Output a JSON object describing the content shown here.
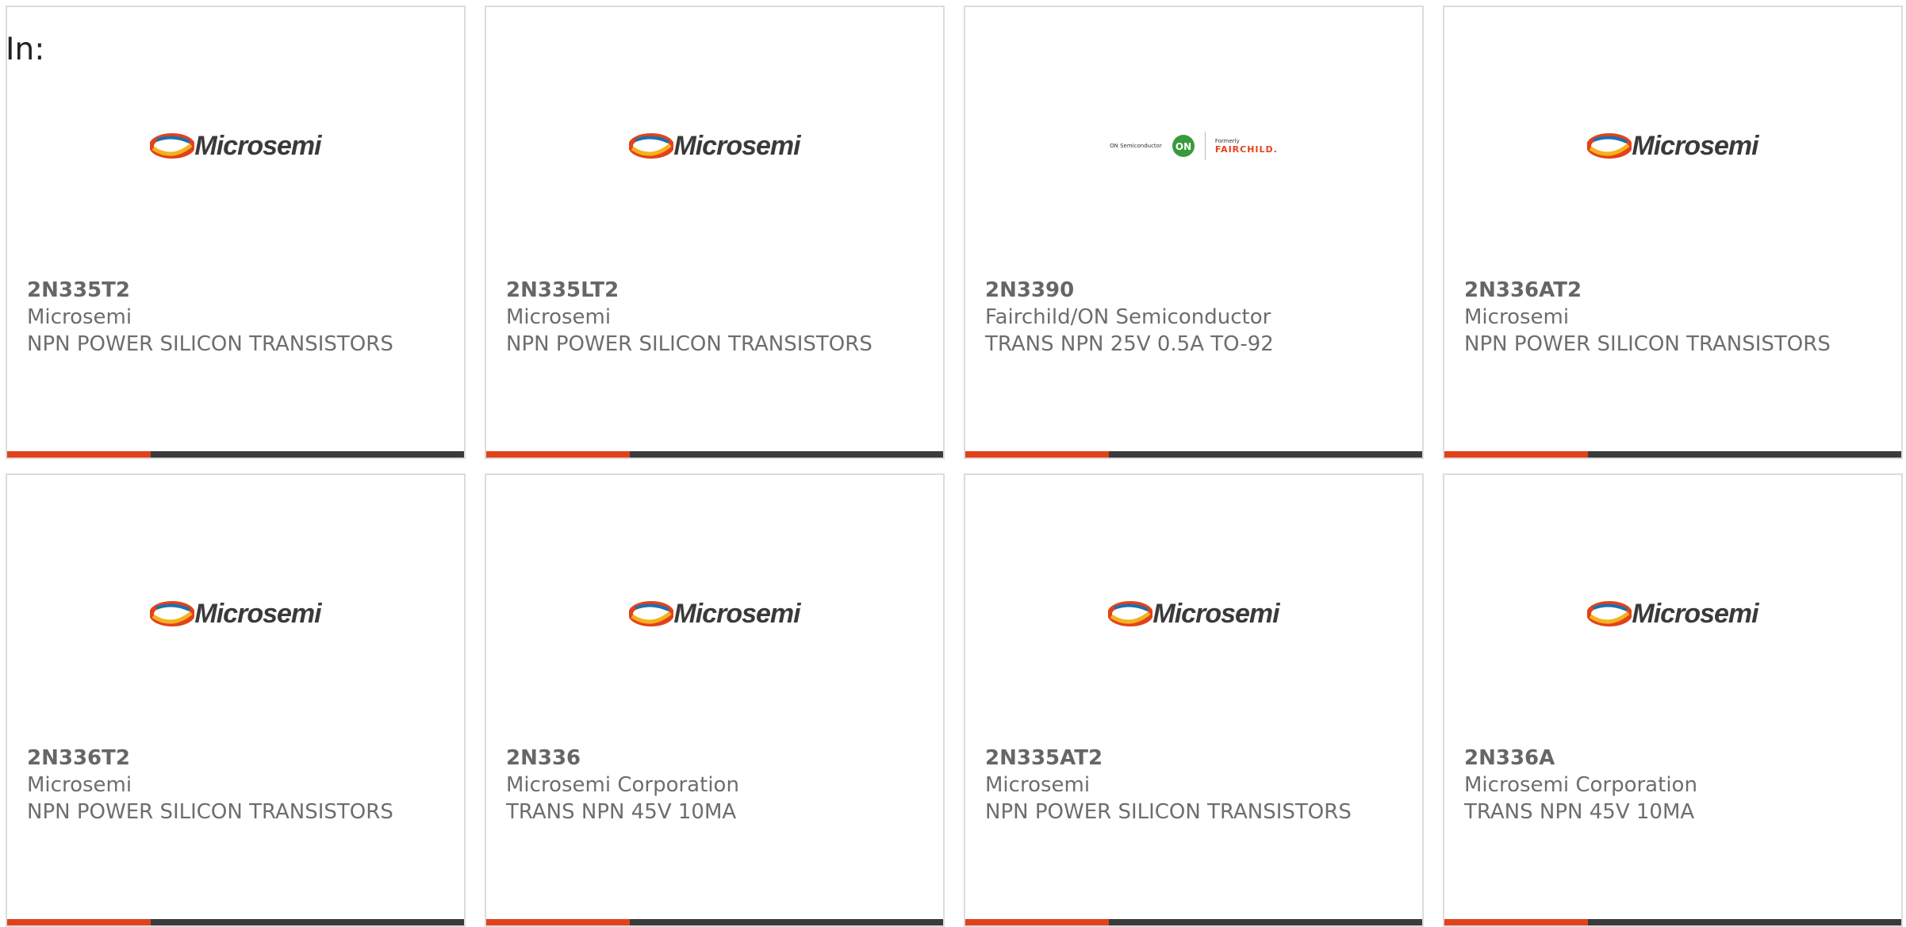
{
  "filter_label": "In:",
  "colors": {
    "accent": "#e2421b",
    "bar": "#3b3b3b",
    "text": "#6d6d6d",
    "border": "#dcdcdc"
  },
  "cards": [
    {
      "part": "2N335T2",
      "manufacturer": "Microsemi",
      "description": "NPN POWER SILICON TRANSISTORS",
      "logo": "microsemi-logo",
      "logo_text": "Microsemi"
    },
    {
      "part": "2N335LT2",
      "manufacturer": "Microsemi",
      "description": "NPN POWER SILICON TRANSISTORS",
      "logo": "microsemi-logo",
      "logo_text": "Microsemi"
    },
    {
      "part": "2N3390",
      "manufacturer": "Fairchild/ON Semiconductor",
      "description": "TRANS NPN 25V 0.5A TO-92",
      "logo": "fairchild-on-logo",
      "logo_text": "ON Semiconductor",
      "logo_text2": "Formerly",
      "logo_text3": "FAIRCHILD."
    },
    {
      "part": "2N336AT2",
      "manufacturer": "Microsemi",
      "description": "NPN POWER SILICON TRANSISTORS",
      "logo": "microsemi-logo",
      "logo_text": "Microsemi"
    },
    {
      "part": "2N336T2",
      "manufacturer": "Microsemi",
      "description": "NPN POWER SILICON TRANSISTORS",
      "logo": "microsemi-logo",
      "logo_text": "Microsemi"
    },
    {
      "part": "2N336",
      "manufacturer": "Microsemi Corporation",
      "description": "TRANS NPN 45V 10MA",
      "logo": "microsemi-logo",
      "logo_text": "Microsemi"
    },
    {
      "part": "2N335AT2",
      "manufacturer": "Microsemi",
      "description": "NPN POWER SILICON TRANSISTORS",
      "logo": "microsemi-logo",
      "logo_text": "Microsemi"
    },
    {
      "part": "2N336A",
      "manufacturer": "Microsemi Corporation",
      "description": "TRANS NPN 45V 10MA",
      "logo": "microsemi-logo",
      "logo_text": "Microsemi"
    }
  ]
}
